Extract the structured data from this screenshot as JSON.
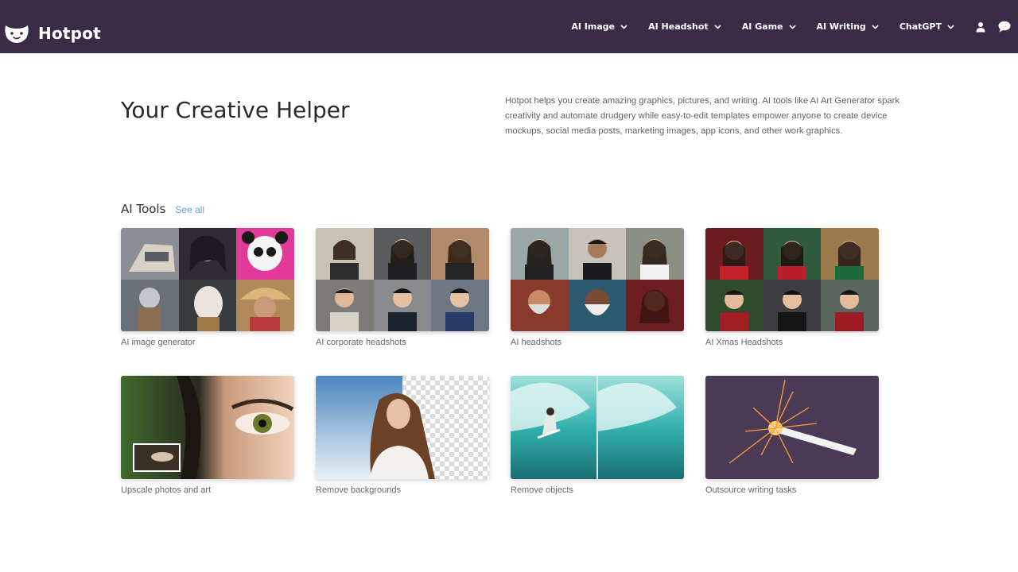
{
  "brand": {
    "name": "Hotpot"
  },
  "nav": {
    "items": [
      {
        "label": "AI Image"
      },
      {
        "label": "AI Headshot"
      },
      {
        "label": "AI Game"
      },
      {
        "label": "AI Writing"
      },
      {
        "label": "ChatGPT"
      }
    ],
    "icons": [
      "user-icon",
      "chat-icon",
      "chevron-down-icon"
    ]
  },
  "hero": {
    "title": "Your Creative Helper",
    "description": "Hotpot helps you create amazing graphics, pictures, and writing. AI tools like AI Art Generator spark creativity and automate drudgery while easy-to-edit templates empower anyone to create device mockups, social media posts, marketing images, app icons, and other work graphics."
  },
  "tools_section": {
    "title": "AI Tools",
    "see_all": "See all",
    "tools": [
      {
        "label": "AI image generator"
      },
      {
        "label": "AI corporate headshots"
      },
      {
        "label": "AI headshots"
      },
      {
        "label": "AI Xmas Headshots"
      },
      {
        "label": "Upscale photos and art"
      },
      {
        "label": "Remove backgrounds"
      },
      {
        "label": "Remove objects"
      },
      {
        "label": "Outsource writing tasks"
      }
    ]
  },
  "colors": {
    "header_bg": "#3a2b46",
    "link": "#5ba4dc",
    "caption": "#666666"
  }
}
